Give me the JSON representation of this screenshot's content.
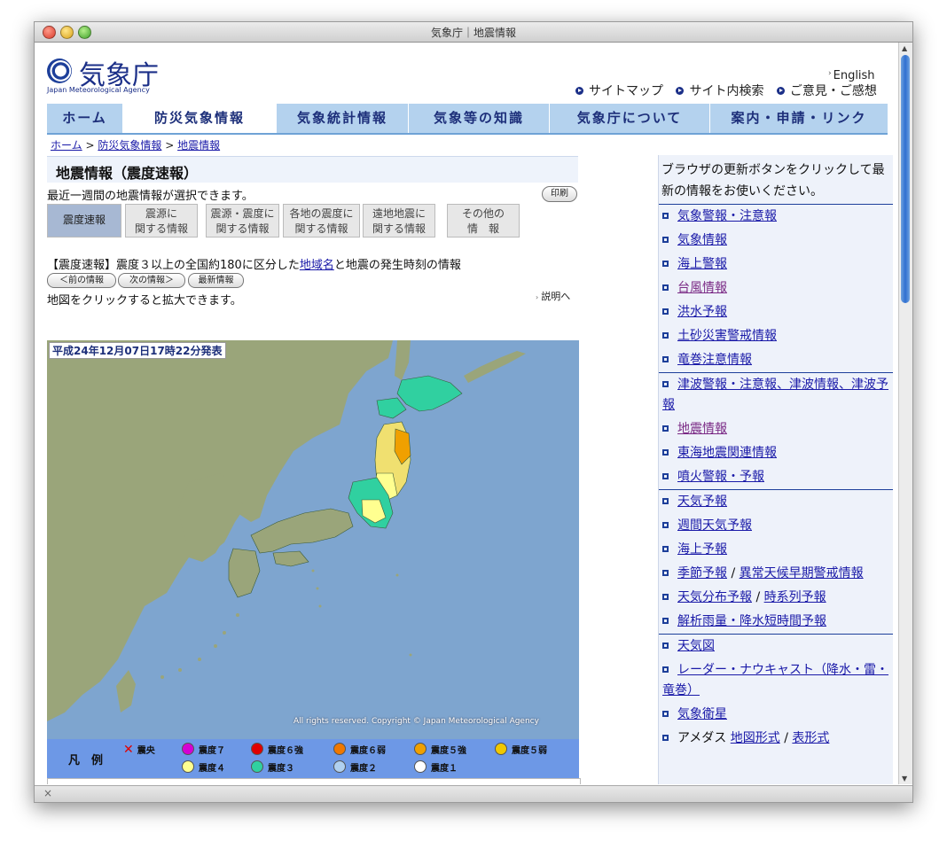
{
  "window": {
    "title": "気象庁｜地震情報"
  },
  "header": {
    "logo_text": "気象庁",
    "logo_sub": "Japan Meteorological Agency",
    "english": "English",
    "links": [
      "サイトマップ",
      "サイト内検索",
      "ご意見・ご感想"
    ]
  },
  "nav": [
    "ホーム",
    "防災気象情報",
    "気象統計情報",
    "気象等の知識",
    "気象庁について",
    "案内・申請・リンク"
  ],
  "breadcrumb": {
    "items": [
      "ホーム",
      "防災気象情報",
      "地震情報"
    ],
    "sep": ">"
  },
  "section_title": "地震情報（震度速報）",
  "intro": "最近一週間の地震情報が選択できます。",
  "print": "印刷",
  "tabs": [
    "震度速報",
    "震源に\n関する情報",
    "震源・震度に\n関する情報",
    "各地の震度に\n関する情報",
    "遠地地震に\n関する情報",
    "その他の\n情　報"
  ],
  "desc": {
    "pre": "【震度速報】震度３以上の全国約180に区分した",
    "link": "地域名",
    "post": "と地震の発生時刻の情報"
  },
  "nav_buttons": [
    "＜前の情報",
    "次の情報＞",
    "最新情報"
  ],
  "click_tip": "地図をクリックすると拡大できます。",
  "explain": "説明へ",
  "map": {
    "date_label": "平成24年12月07日17時22分発表",
    "copyright": "All rights reserved. Copyright © Japan Meteorological Agency"
  },
  "legend": {
    "title": "凡　例",
    "epicenter": "震央",
    "items": [
      {
        "label": "震度７",
        "color": "#d400d4"
      },
      {
        "label": "震度６強",
        "color": "#e00000"
      },
      {
        "label": "震度６弱",
        "color": "#f07800"
      },
      {
        "label": "震度５強",
        "color": "#f0a000"
      },
      {
        "label": "震度５弱",
        "color": "#f0c800"
      },
      {
        "label": "震度４",
        "color": "#ffff90"
      },
      {
        "label": "震度３",
        "color": "#30d0a0"
      },
      {
        "label": "震度２",
        "color": "#b0d0f0"
      },
      {
        "label": "震度１",
        "color": "#ffffff"
      }
    ]
  },
  "sidebar": {
    "note": "ブラウザの更新ボタンをクリックして最新の情報をお使いください。",
    "items": [
      "気象警報・注意報",
      "気象情報",
      "海上警報",
      "台風情報",
      "洪水予報",
      "土砂災害警戒情報",
      "竜巻注意情報",
      "津波警報・注意報、津波情報、津波予報",
      "地震情報",
      "東海地震関連情報",
      "噴火警報・予報",
      "天気予報",
      "週間天気予報",
      "海上予報",
      "季節予報",
      "異常天候早期警戒情報",
      "天気分布予報",
      "時系列予報",
      "解析雨量・降水短時間予報",
      "天気図",
      "レーダー・ナウキャスト（降水・雷・竜巻）",
      "気象衛星",
      "アメダス",
      "地図形式",
      "表形式"
    ],
    "slash": "/"
  },
  "colors": {
    "accent": "#1d2f7a",
    "nav_bg": "#b4d2ee",
    "legend_bg": "#6d98e6",
    "sea": "#7ea5cf",
    "land": "#9aa57a"
  }
}
